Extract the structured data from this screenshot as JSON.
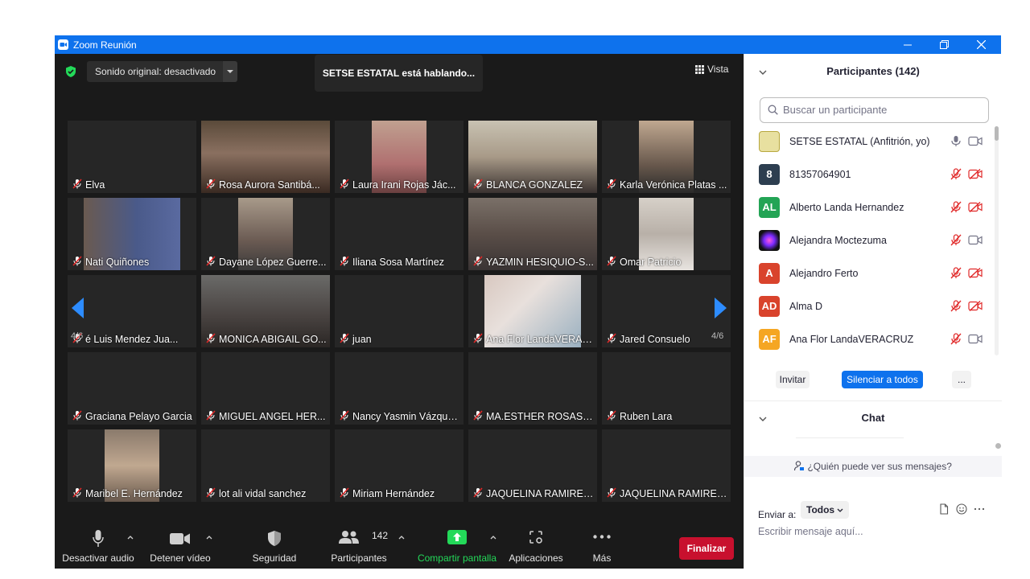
{
  "window": {
    "title": "Zoom Reunión",
    "accent": "#0e72ed"
  },
  "topbar": {
    "sound_label": "Sonido original: desactivado",
    "speaking_label": "SETSE ESTATAL está hablando...",
    "view_label": "Vista"
  },
  "gallery": {
    "page_left": "4/6",
    "page_right": "4/6",
    "tiles": [
      {
        "name": "Elva",
        "video": false
      },
      {
        "name": "Rosa Aurora Santibá...",
        "video": true
      },
      {
        "name": "Laura Irani Rojas Jác...",
        "video": true
      },
      {
        "name": "BLANCA GONZALEZ",
        "video": true
      },
      {
        "name": "Karla Verónica Platas ...",
        "video": true
      },
      {
        "name": "Nati Quiñones",
        "video": true
      },
      {
        "name": "Dayane López Guerre...",
        "video": true
      },
      {
        "name": "Iliana Sosa Martínez",
        "video": false
      },
      {
        "name": "YAZMIN HESIQUIO-S...",
        "video": true
      },
      {
        "name": "Omar Patricio",
        "video": true
      },
      {
        "name": "é Luis Mendez Jua...",
        "video": false
      },
      {
        "name": "MONICA ABIGAIL GO...",
        "video": true
      },
      {
        "name": "juan",
        "video": false
      },
      {
        "name": "Ana Flor LandaVERAC...",
        "video": true
      },
      {
        "name": "Jared Consuelo",
        "video": false
      },
      {
        "name": "Graciana Pelayo Garcia",
        "video": false
      },
      {
        "name": "MIGUEL ANGEL HER...",
        "video": false
      },
      {
        "name": "Nancy Yasmin Vázque...",
        "video": false
      },
      {
        "name": "MA.ESTHER ROSAS O...",
        "video": false
      },
      {
        "name": "Ruben Lara",
        "video": false
      },
      {
        "name": "Maribel E. Hernández",
        "video": true
      },
      {
        "name": "lot ali vidal sanchez",
        "video": false
      },
      {
        "name": "Miriam Hernández",
        "video": false
      },
      {
        "name": "JAQUELINA RAMIREZ...",
        "video": false
      },
      {
        "name": "JAQUELINA RAMIREZ...",
        "video": false
      }
    ]
  },
  "toolbar": {
    "mute_label": "Desactivar audio",
    "video_label": "Detener vídeo",
    "security_label": "Seguridad",
    "participants_label": "Participantes",
    "participants_count": "142",
    "share_label": "Compartir pantalla",
    "apps_label": "Aplicaciones",
    "more_label": "Más",
    "end_label": "Finalizar",
    "share_color": "#23d959",
    "end_color": "#c8102e"
  },
  "participants_panel": {
    "title": "Participantes (142)",
    "search_placeholder": "Buscar un participante",
    "list": [
      {
        "name": "SETSE ESTATAL (Anfitrión, yo)",
        "initials": "",
        "color": "#e8e0a0",
        "muted": false,
        "video_off": false
      },
      {
        "name": "81357064901",
        "initials": "8",
        "color": "#2d3e50",
        "muted": true,
        "video_off": true
      },
      {
        "name": "Alberto Landa Hernandez",
        "initials": "AL",
        "color": "#23a455",
        "muted": true,
        "video_off": true
      },
      {
        "name": "Alejandra Moctezuma",
        "initials": "",
        "color": "#1a1a2e",
        "muted": true,
        "video_off": false
      },
      {
        "name": "Alejandro Ferto",
        "initials": "A",
        "color": "#d9432c",
        "muted": true,
        "video_off": true
      },
      {
        "name": "Alma D",
        "initials": "AD",
        "color": "#d9432c",
        "muted": true,
        "video_off": true
      },
      {
        "name": "Ana Flor LandaVERACRUZ",
        "initials": "AF",
        "color": "#f5a623",
        "muted": true,
        "video_off": false
      }
    ],
    "invite_label": "Invitar",
    "mute_all_label": "Silenciar a todos",
    "more_label": "..."
  },
  "chat_panel": {
    "title": "Chat",
    "who_can_see": "¿Quién puede ver sus mensajes?",
    "send_to_label": "Enviar a:",
    "send_to_value": "Todos",
    "input_placeholder": "Escribir mensaje aquí..."
  }
}
